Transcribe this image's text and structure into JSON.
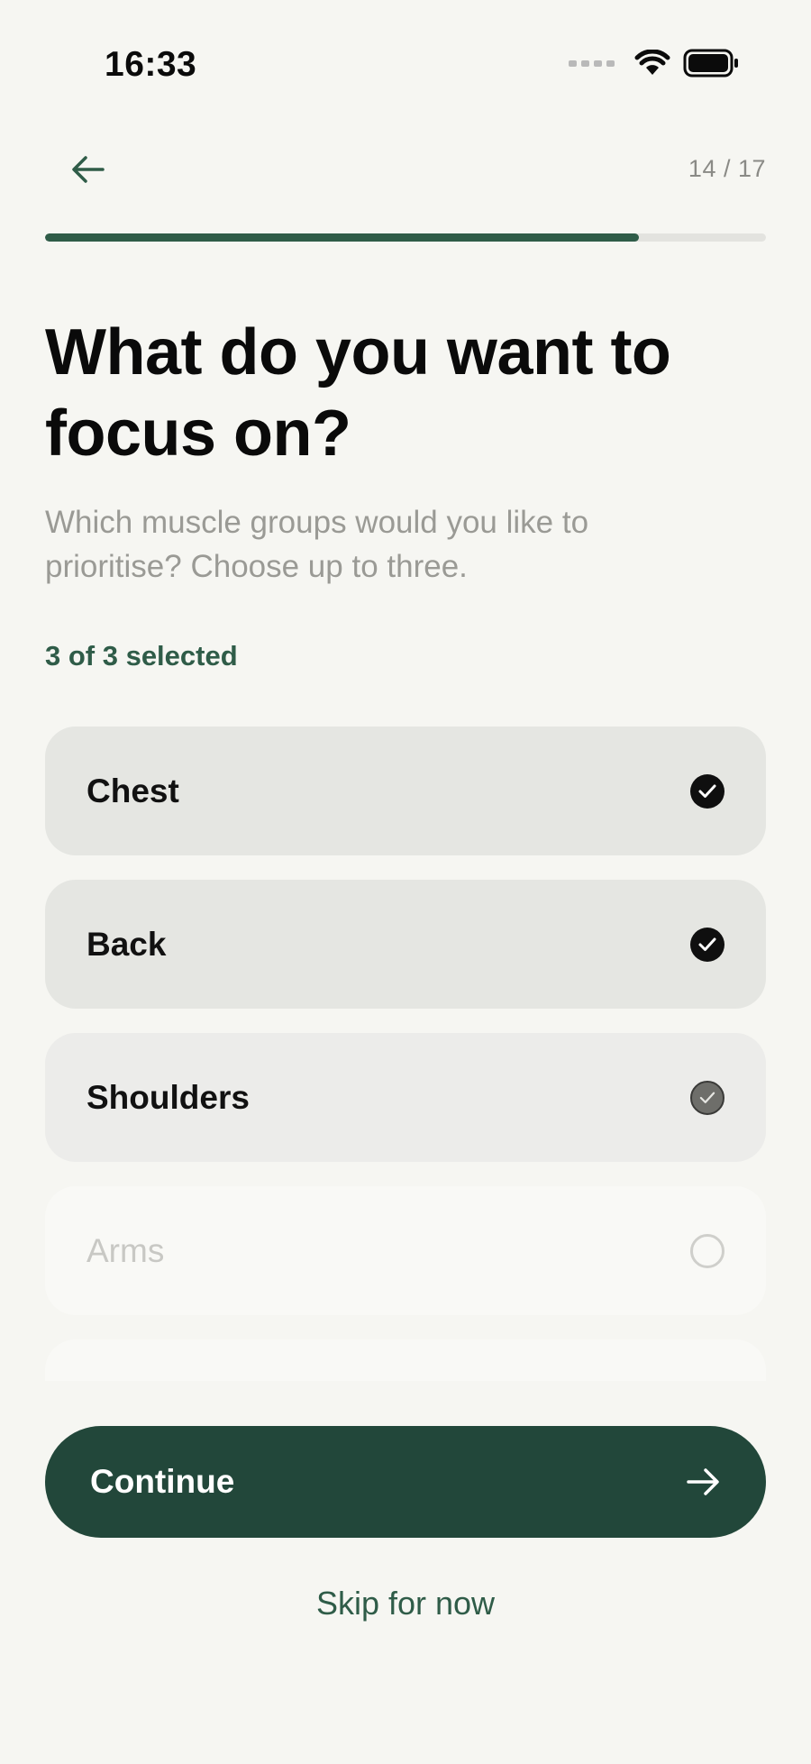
{
  "status_bar": {
    "time": "16:33"
  },
  "header": {
    "step_counter": "14 / 17",
    "progress_fraction": 0.824
  },
  "title": "What do you want to focus on?",
  "subtitle": "Which muscle groups would you like to prioritise? Choose up to three.",
  "selected_count": "3 of 3 selected",
  "options": [
    {
      "label": "Chest",
      "selected": true
    },
    {
      "label": "Back",
      "selected": true
    },
    {
      "label": "Shoulders",
      "selected": true
    },
    {
      "label": "Arms",
      "selected": false
    }
  ],
  "continue_label": "Continue",
  "skip_label": "Skip for now",
  "colors": {
    "accent": "#2f5c48",
    "button": "#22473a",
    "background": "#f6f6f2"
  }
}
